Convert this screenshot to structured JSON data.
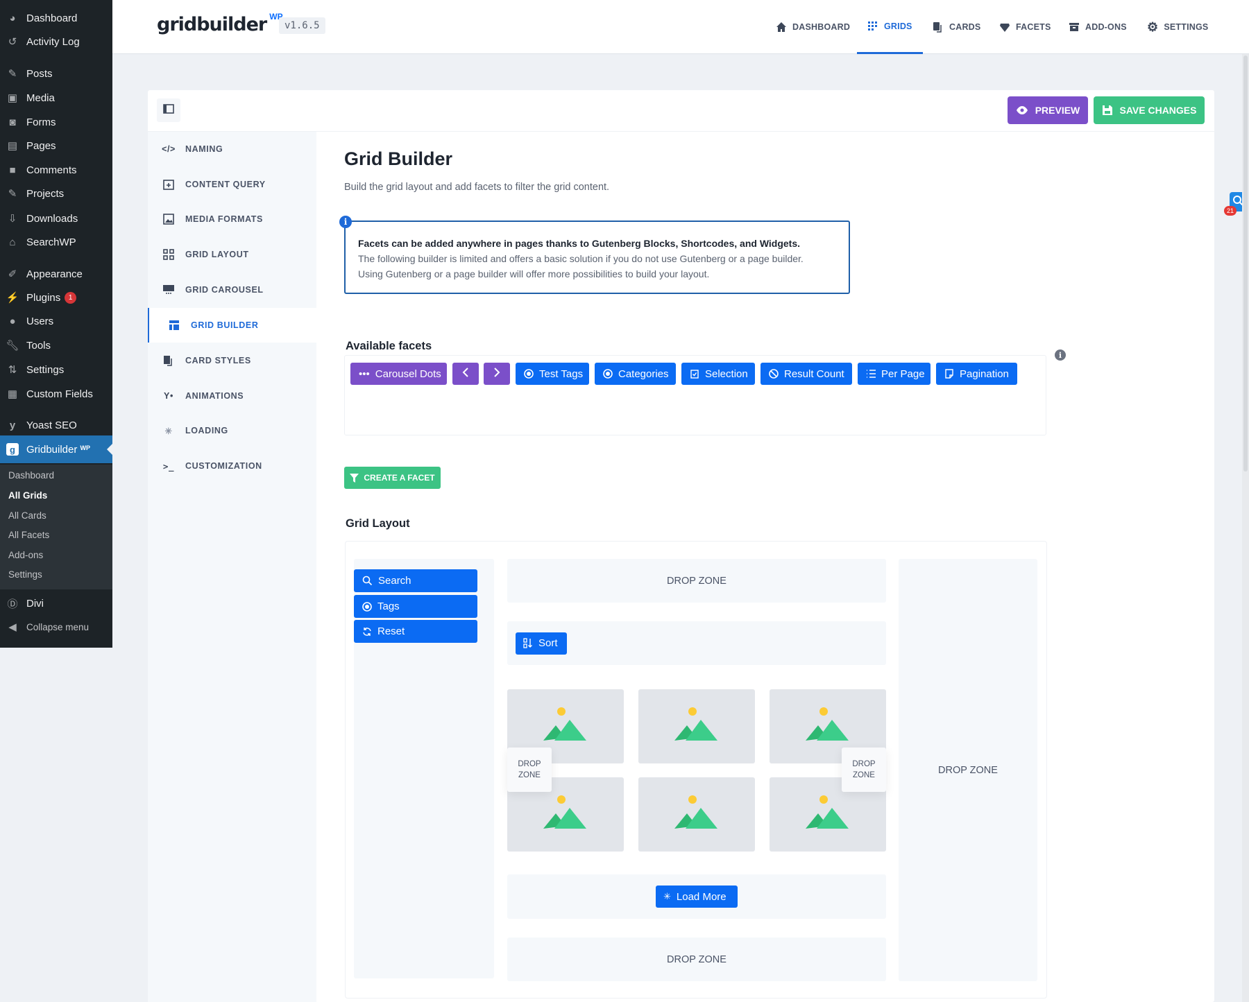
{
  "wp_menu": [
    {
      "label": "Dashboard",
      "icon": "dashboard-icon"
    },
    {
      "label": "Activity Log",
      "icon": "history-icon"
    },
    {
      "label": "Posts",
      "icon": "pin-icon"
    },
    {
      "label": "Media",
      "icon": "media-icon"
    },
    {
      "label": "Forms",
      "icon": "forms-icon"
    },
    {
      "label": "Pages",
      "icon": "pages-icon"
    },
    {
      "label": "Comments",
      "icon": "comment-icon"
    },
    {
      "label": "Projects",
      "icon": "pin-icon"
    },
    {
      "label": "Downloads",
      "icon": "download-icon"
    },
    {
      "label": "SearchWP",
      "icon": "lantern-icon"
    },
    {
      "label": "Appearance",
      "icon": "brush-icon"
    },
    {
      "label": "Plugins",
      "icon": "plug-icon",
      "badge": "1"
    },
    {
      "label": "Users",
      "icon": "user-icon"
    },
    {
      "label": "Tools",
      "icon": "wrench-icon"
    },
    {
      "label": "Settings",
      "icon": "settings-icon"
    },
    {
      "label": "Custom Fields",
      "icon": "table-icon"
    },
    {
      "label": "Yoast SEO",
      "icon": "yoast-icon"
    }
  ],
  "wp_active": {
    "label": "Gridbuilder",
    "sup": "WP"
  },
  "wp_submenu": [
    "Dashboard",
    "All Grids",
    "All Cards",
    "All Facets",
    "Add-ons",
    "Settings"
  ],
  "wp_bottom": [
    {
      "label": "Divi"
    },
    {
      "label": "Collapse menu"
    }
  ],
  "header": {
    "logo": "gridbuilder",
    "logo_sup": "WP",
    "version": "v1.6.5",
    "nav": [
      "DASHBOARD",
      "GRIDS",
      "CARDS",
      "FACETS",
      "ADD-ONS",
      "SETTINGS"
    ],
    "active_nav": "GRIDS"
  },
  "toolbar": {
    "preview_label": "PREVIEW",
    "save_label": "SAVE CHANGES"
  },
  "settings_nav": [
    "NAMING",
    "CONTENT QUERY",
    "MEDIA FORMATS",
    "GRID LAYOUT",
    "GRID CAROUSEL",
    "GRID BUILDER",
    "CARD STYLES",
    "ANIMATIONS",
    "LOADING",
    "CUSTOMIZATION"
  ],
  "settings_active": "GRID BUILDER",
  "main": {
    "title": "Grid Builder",
    "subtitle": "Build the grid layout and add facets to filter the grid content.",
    "notice_bold": "Facets can be added anywhere in pages thanks to Gutenberg Blocks, Shortcodes, and Widgets.",
    "notice_line1": "The following builder is limited and offers a basic solution if you do not use Gutenberg or a page builder.",
    "notice_line2": "Using Gutenberg or a page builder will offer more possibilities to build your layout.",
    "facets_heading": "Available facets",
    "facets": [
      {
        "label": "Carousel Dots",
        "color": "#7b4fc9"
      },
      {
        "label": "",
        "color": "#7b4fc9",
        "icon": "chevron-left-icon"
      },
      {
        "label": "",
        "color": "#7b4fc9",
        "icon": "chevron-right-icon"
      },
      {
        "label": "Test Tags",
        "color": "#0b6bf3"
      },
      {
        "label": "Categories",
        "color": "#0b6bf3"
      },
      {
        "label": "Selection",
        "color": "#0b6bf3"
      },
      {
        "label": "Result Count",
        "color": "#0b6bf3"
      },
      {
        "label": "Per Page",
        "color": "#0b6bf3"
      },
      {
        "label": "Pagination",
        "color": "#0b6bf3"
      }
    ],
    "create_facet_label": "CREATE A FACET",
    "grid_layout_heading": "Grid Layout",
    "left_facets": [
      "Search",
      "Tags",
      "Reset"
    ],
    "sort_label": "Sort",
    "load_more_label": "Load More",
    "drop_zone": "DROP ZONE",
    "drop_zone_small": [
      "DROP",
      "ZONE"
    ]
  },
  "float_badge": "21"
}
